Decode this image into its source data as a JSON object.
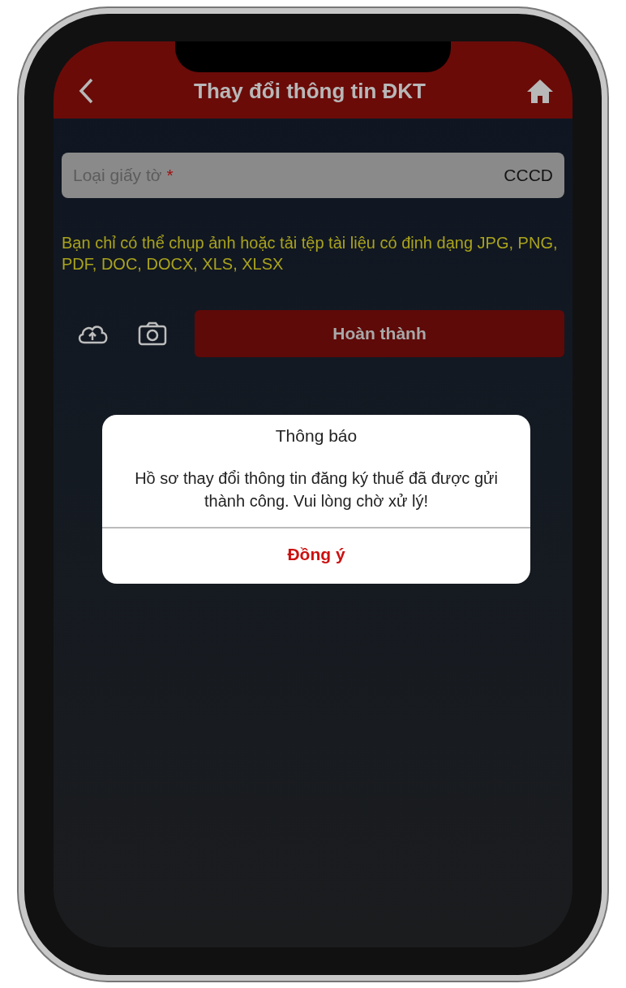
{
  "header": {
    "title": "Thay đổi thông tin ĐKT"
  },
  "document_type": {
    "label": "Loại giấy tờ",
    "required_mark": "*",
    "value": "CCCD"
  },
  "hint": "Bạn chỉ có thể chụp ảnh hoặc tải tệp tài liệu có định dạng JPG, PNG, PDF, DOC, DOCX, XLS, XLSX",
  "submit_button": {
    "label": "Hoàn thành"
  },
  "dialog": {
    "title": "Thông báo",
    "message": "Hồ sơ thay đổi thông tin đăng ký thuế đã được gửi thành công. Vui lòng chờ xử lý!",
    "button": "Đồng ý"
  }
}
